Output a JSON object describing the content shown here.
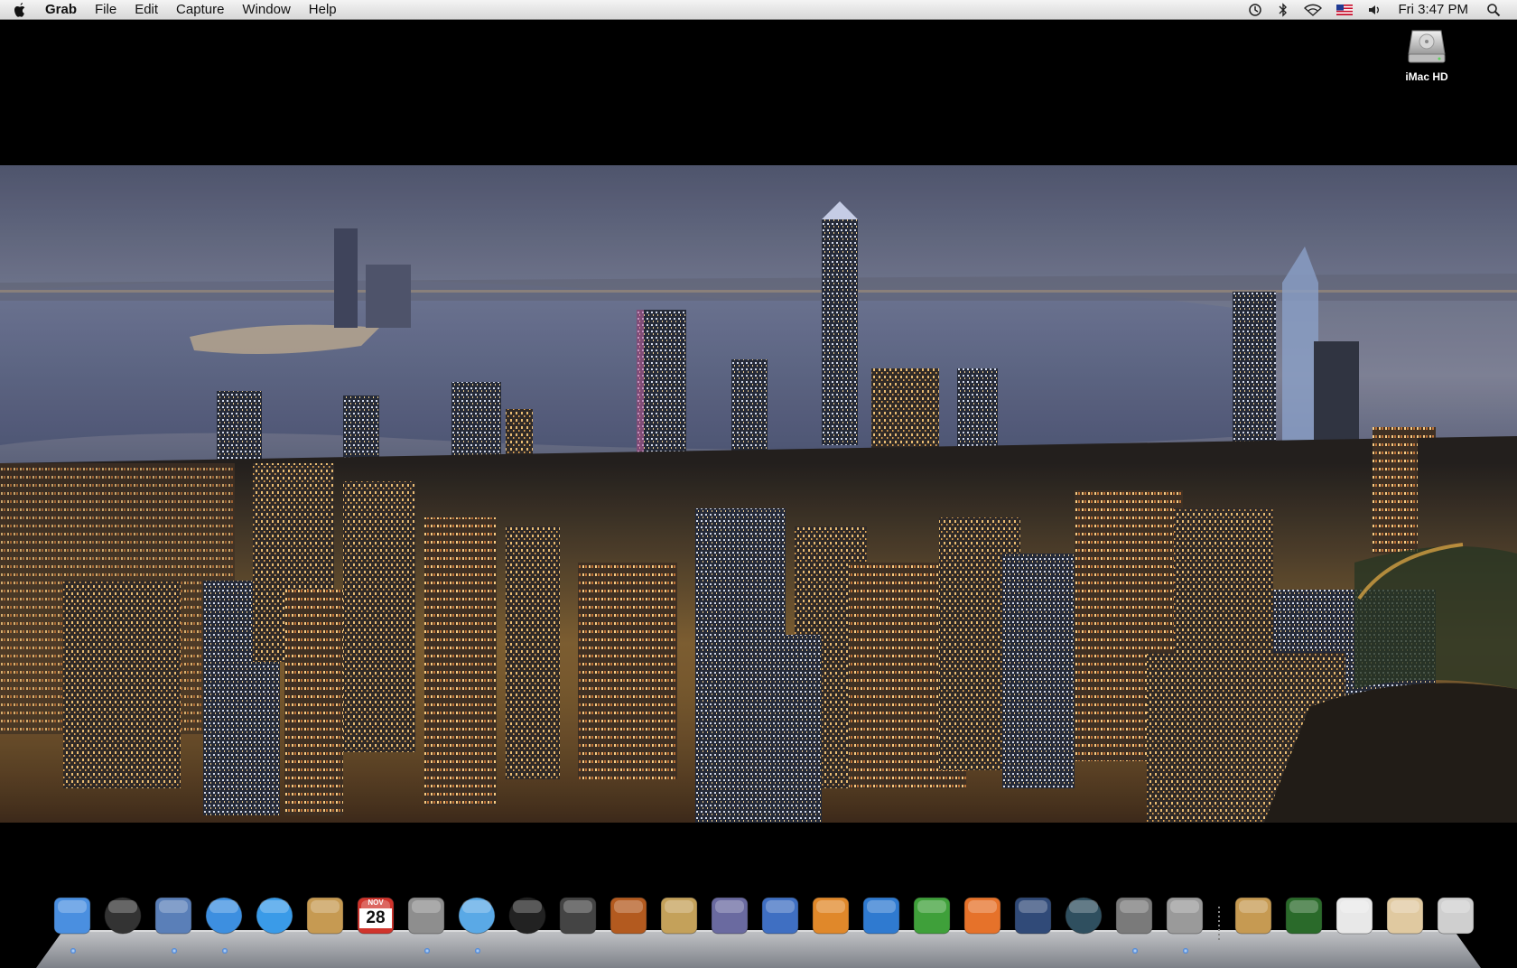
{
  "menubar": {
    "app_name": "Grab",
    "items": [
      "File",
      "Edit",
      "Capture",
      "Window",
      "Help"
    ],
    "status_icons": [
      "time-machine-icon",
      "bluetooth-icon",
      "wifi-icon",
      "us-flag-input-icon",
      "volume-icon"
    ],
    "clock": "Fri 3:47 PM"
  },
  "desktop": {
    "drive_label": "iMac HD"
  },
  "dock": {
    "apps": [
      {
        "name": "finder-icon",
        "color": "#4a8fe0"
      },
      {
        "name": "dashboard-icon",
        "color": "#333333"
      },
      {
        "name": "mail-icon",
        "color": "#5a7fb8"
      },
      {
        "name": "safari-icon",
        "color": "#3d8fe0"
      },
      {
        "name": "ichat-icon",
        "color": "#3a9be8"
      },
      {
        "name": "address-book-icon",
        "color": "#c69a52"
      },
      {
        "name": "ical-icon",
        "color": "#d0342c",
        "date_month": "NOV",
        "date_day": "28"
      },
      {
        "name": "preview-icon",
        "color": "#8e8e8e"
      },
      {
        "name": "itunes-icon",
        "color": "#5aa9e6"
      },
      {
        "name": "photo-booth-icon",
        "color": "#222222"
      },
      {
        "name": "imovie-icon",
        "color": "#444444"
      },
      {
        "name": "garageband-icon",
        "color": "#b35a1f"
      },
      {
        "name": "iphoto-icon",
        "color": "#c4a15a"
      },
      {
        "name": "script-editor-icon",
        "color": "#6a6aa0"
      },
      {
        "name": "keynote-numbers-icon",
        "color": "#3f6fc2"
      },
      {
        "name": "keynote-icon",
        "color": "#e0882a"
      },
      {
        "name": "word-icon",
        "color": "#2f7ad0"
      },
      {
        "name": "excel-icon",
        "color": "#3fa03a"
      },
      {
        "name": "powerpoint-icon",
        "color": "#e6722a"
      },
      {
        "name": "spaces-icon",
        "color": "#304a78"
      },
      {
        "name": "time-machine-icon",
        "color": "#2f4f5f"
      },
      {
        "name": "system-preferences-icon",
        "color": "#7a7a7a"
      },
      {
        "name": "grab-scissors-icon",
        "color": "#9a9a9a"
      }
    ],
    "stacks": [
      {
        "name": "address-book-doc-icon",
        "color": "#c69a52"
      },
      {
        "name": "activity-monitor-icon",
        "color": "#2a6a2a"
      },
      {
        "name": "pdf-document-icon",
        "color": "#e8e8e8"
      },
      {
        "name": "pdf-stack-icon",
        "color": "#e0c9a0"
      },
      {
        "name": "trash-icon",
        "color": "#cfcfcf"
      }
    ]
  }
}
